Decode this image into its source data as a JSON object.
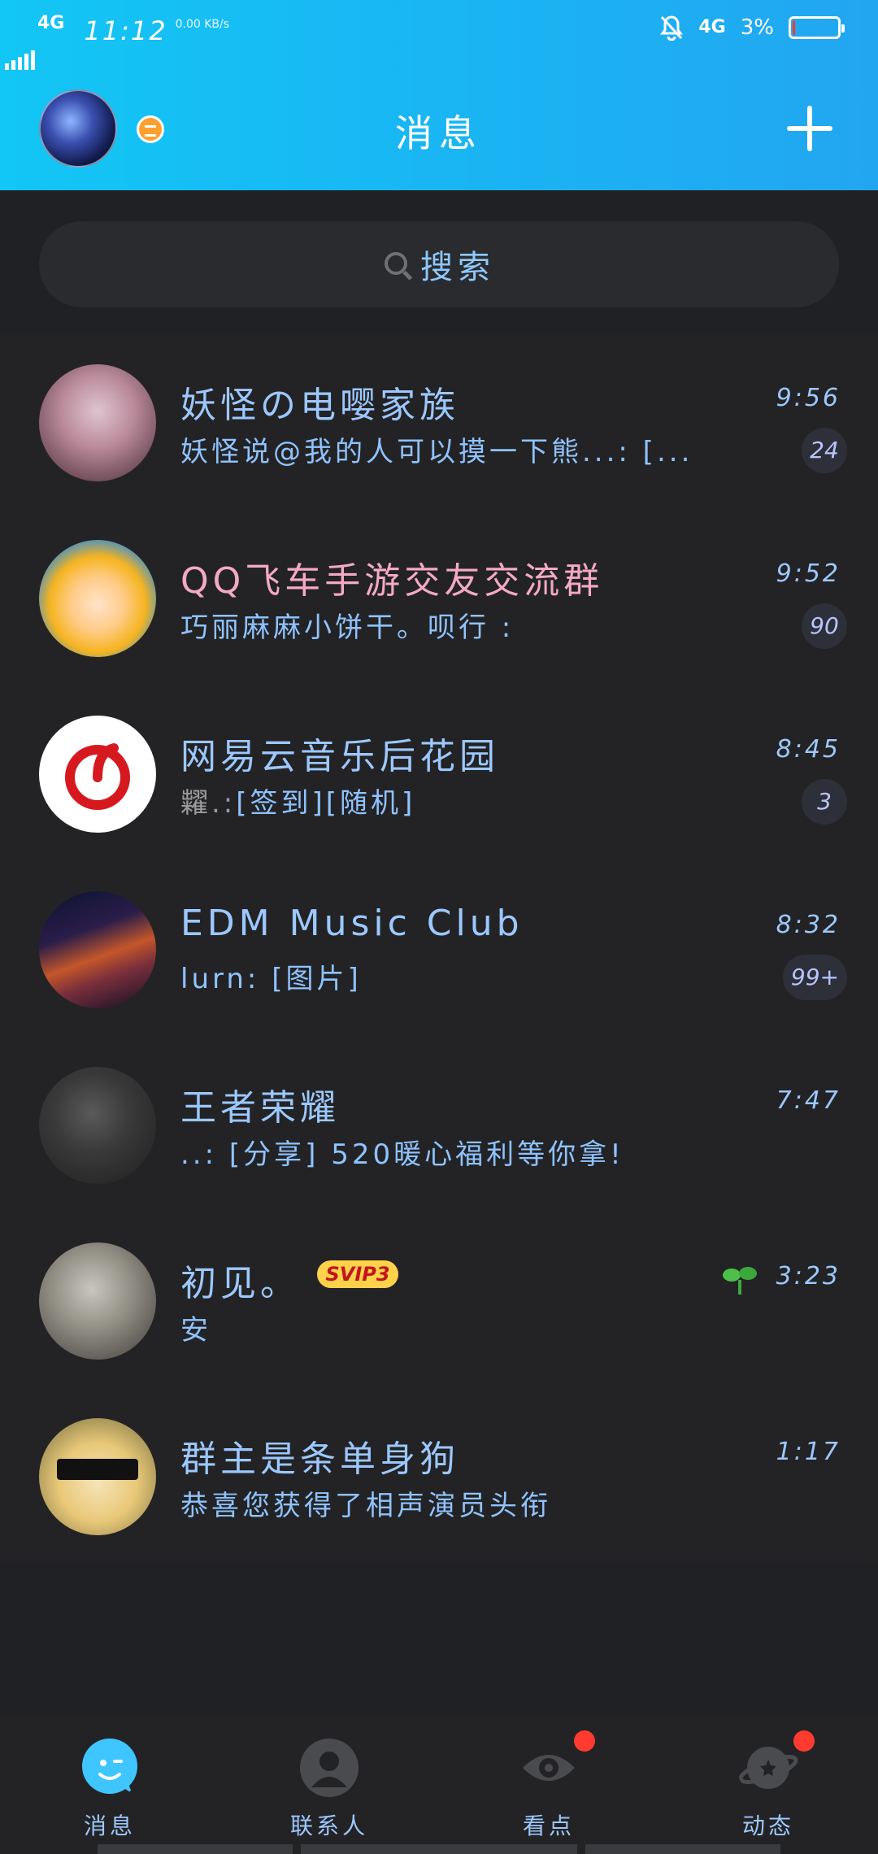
{
  "status_bar": {
    "network": "4G",
    "time": "11:12",
    "speed": "0.00 KB/s",
    "net_right": "4G",
    "battery": "3%",
    "battery_level": 0.03
  },
  "header": {
    "title": "消息"
  },
  "search": {
    "placeholder": "搜索"
  },
  "conversations": [
    {
      "name": "妖怪の电嘤家族",
      "preview": "妖怪说@我的人可以摸一下熊...: [...",
      "time": "9:56",
      "badge": "24",
      "name_color": "#9cc8ff"
    },
    {
      "name": "QQ飞车手游交友交流群",
      "preview": "巧丽麻麻小饼干。呗行 :",
      "time": "9:52",
      "badge": "90",
      "name_color": "#f4a9c4"
    },
    {
      "name": "网易云音乐后花园",
      "preview_gray": "糶.:",
      "preview": "[签到][随机]",
      "time": "8:45",
      "badge": "3",
      "name_color": "#9cc8ff"
    },
    {
      "name": "EDM Music Club",
      "preview": "lurn: [图片]",
      "time": "8:32",
      "badge": "99+",
      "name_color": "#9cc8ff"
    },
    {
      "name": "王者荣耀",
      "preview": "..: [分享] 520暖心福利等你拿!",
      "time": "7:47",
      "name_color": "#9cc8ff"
    },
    {
      "name": "初见。",
      "vip": "SVIP3",
      "preview": "安",
      "time": "3:23",
      "name_color": "#9cc8ff"
    },
    {
      "name": "群主是条单身狗",
      "preview": "恭喜您获得了相声演员头衔",
      "time": "1:17",
      "name_color": "#9cc8ff"
    }
  ],
  "tabs": [
    {
      "label": "消息",
      "icon": "chat-bubble-icon"
    },
    {
      "label": "联系人",
      "icon": "contacts-icon"
    },
    {
      "label": "看点",
      "icon": "eye-icon",
      "has_dot": true
    },
    {
      "label": "动态",
      "icon": "planet-icon",
      "has_dot": true
    }
  ]
}
